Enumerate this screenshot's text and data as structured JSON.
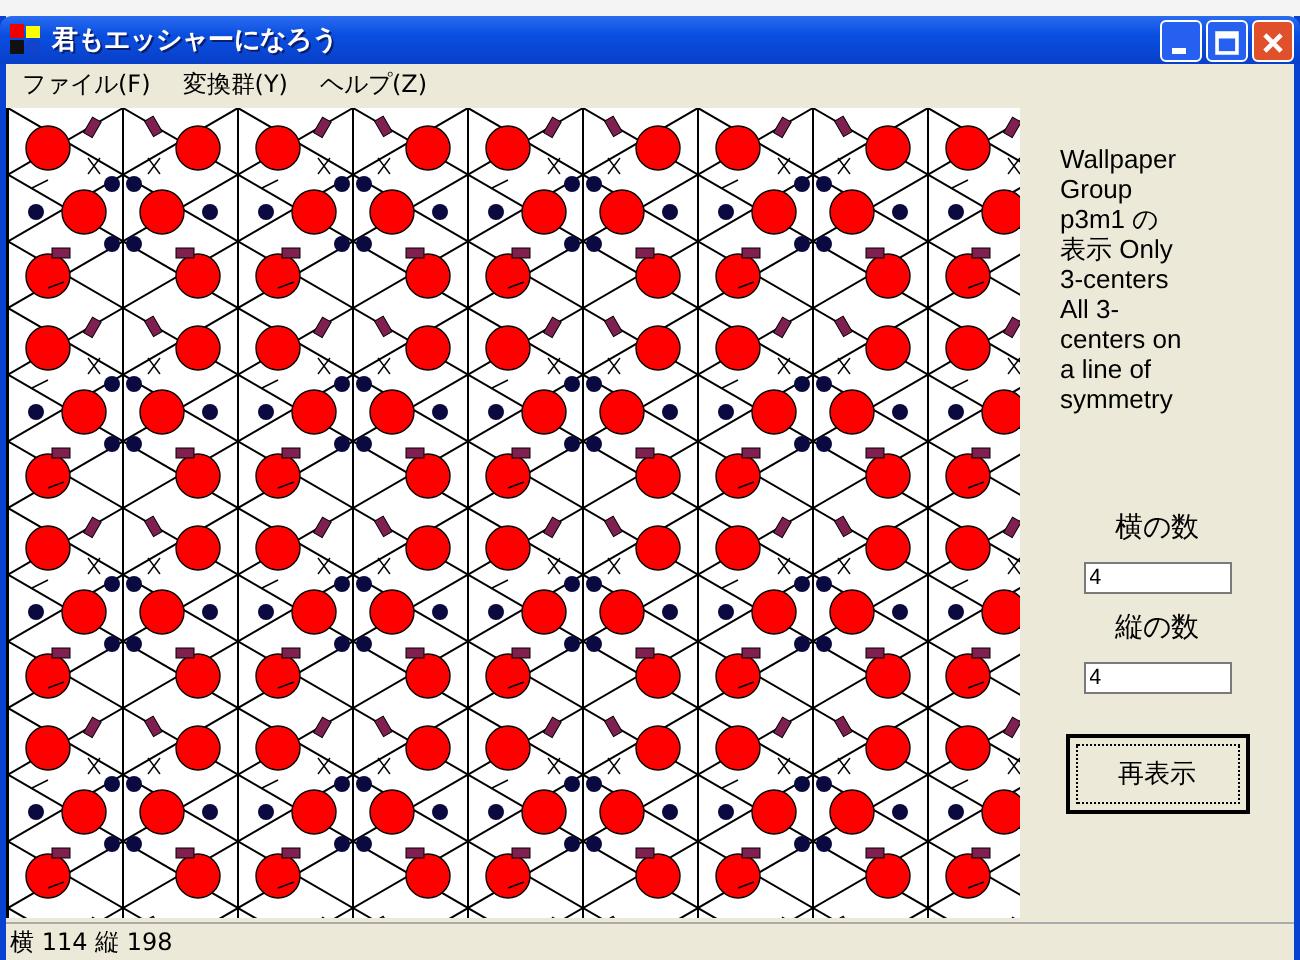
{
  "window": {
    "title": "君もエッシャーになろう"
  },
  "menu": [
    {
      "label": "ファイル(F)"
    },
    {
      "label": "変換群(Y)"
    },
    {
      "label": "ヘルプ(Z)"
    }
  ],
  "panel": {
    "description": "Wallpaper Group p3m1 の表示 Only 3-centers All 3-centers on a line of symmetry",
    "fields": [
      {
        "label": "横の数",
        "value": "4"
      },
      {
        "label": "縦の数",
        "value": "4"
      }
    ],
    "button": "再表示"
  },
  "status_bar": "横 114 縦 198"
}
